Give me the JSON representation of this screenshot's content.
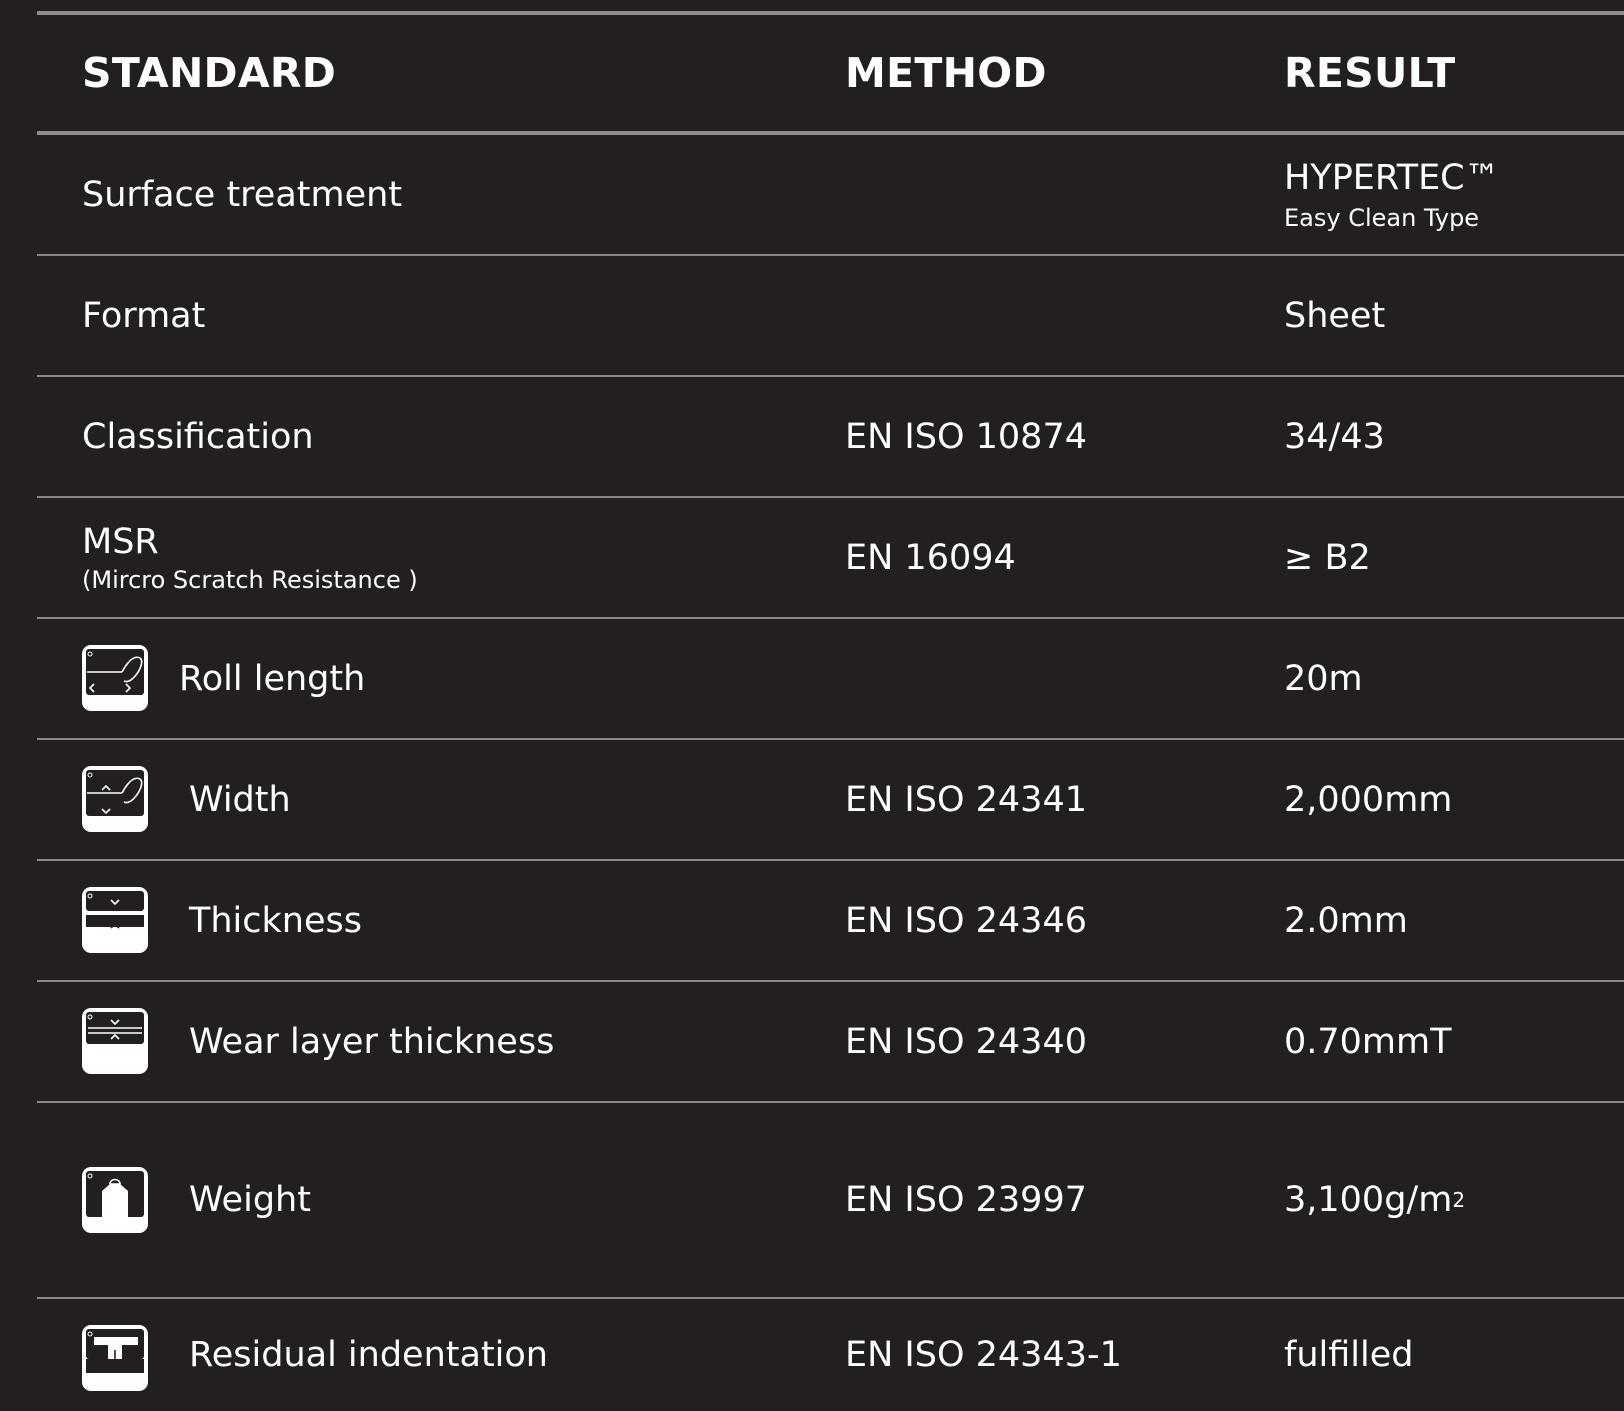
{
  "header": {
    "standard": "STANDARD",
    "method": "METHOD",
    "result": "RESULT"
  },
  "rows": [
    {
      "standard": "Surface treatment",
      "method": "",
      "result": "HYPERTEC™",
      "result_sub": "Easy Clean Type"
    },
    {
      "standard": "Format",
      "method": "",
      "result": "Sheet"
    },
    {
      "standard": "Classification",
      "method": "EN ISO 10874",
      "result": "34/43"
    },
    {
      "standard": "MSR",
      "standard_sub": "(Mircro Scratch Resistance )",
      "method": "EN 16094",
      "result": "≥ B2"
    },
    {
      "standard": "Roll length",
      "icon": "roll-length-icon",
      "method": "",
      "result": "20m"
    },
    {
      "standard": "Width",
      "icon": "width-icon",
      "method": "EN ISO 24341",
      "result": "2,000mm"
    },
    {
      "standard": "Thickness",
      "icon": "thickness-icon",
      "method": "EN ISO 24346",
      "result": "2.0mm"
    },
    {
      "standard": "Wear layer thickness",
      "icon": "wear-layer-icon",
      "method": "EN ISO 24340",
      "result": "0.70mmT"
    },
    {
      "standard": "Weight",
      "icon": "weight-icon",
      "method": "EN ISO 23997",
      "result": "3,100g/m",
      "result_sup": "2"
    },
    {
      "standard": "Residual indentation",
      "icon": "residual-indentation-icon",
      "method": "EN ISO 24343-1",
      "result": "fulfilled"
    }
  ],
  "colors": {
    "background": "#231f20",
    "text": "#ffffff",
    "rule": "#8a8788"
  }
}
